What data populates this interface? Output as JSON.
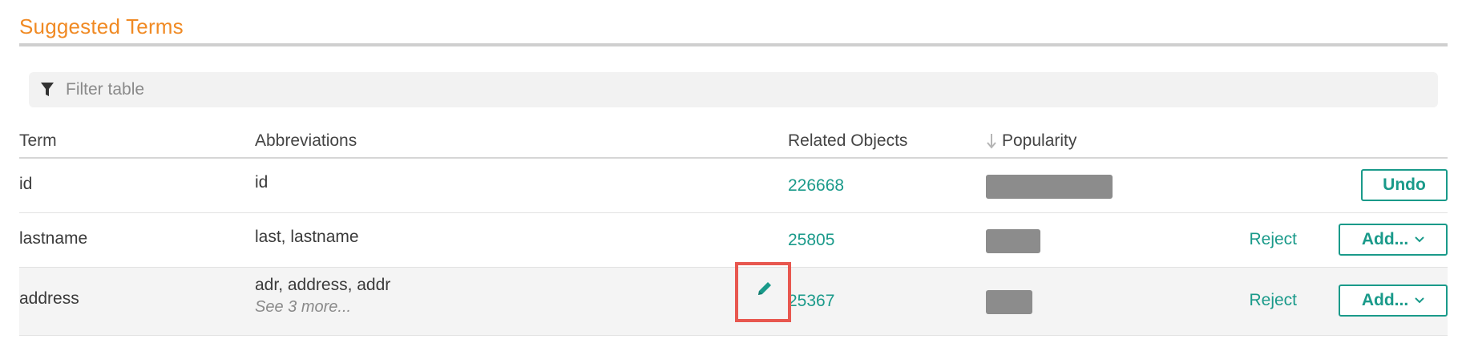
{
  "section": {
    "title": "Suggested Terms"
  },
  "filter": {
    "icon": "filter-icon",
    "placeholder": "Filter table",
    "value": ""
  },
  "table": {
    "headers": {
      "term": "Term",
      "abbreviations": "Abbreviations",
      "related_objects": "Related Objects",
      "popularity": "Popularity",
      "popularity_sort_icon": "arrow-down-icon"
    },
    "rows": [
      {
        "term": "id",
        "abbreviations": "id",
        "see_more": "",
        "related_objects": "226668",
        "popularity": 0.95,
        "actions": {
          "primary": "Undo",
          "reject": ""
        }
      },
      {
        "term": "lastname",
        "abbreviations": "last, lastname",
        "see_more": "",
        "related_objects": "25805",
        "popularity": 0.41,
        "actions": {
          "primary": "Add...",
          "reject": "Reject"
        }
      },
      {
        "term": "address",
        "abbreviations": "adr, address, addr",
        "see_more": "See 3 more...",
        "related_objects": "25367",
        "popularity": 0.35,
        "actions": {
          "primary": "Add...",
          "reject": "Reject"
        }
      }
    ]
  },
  "edit_control": {
    "icon": "pencil-icon",
    "highlight_color": "#e8574f"
  },
  "colors": {
    "accent": "#f08a24",
    "link": "#1a9a8a",
    "bar": "#8c8c8c"
  }
}
